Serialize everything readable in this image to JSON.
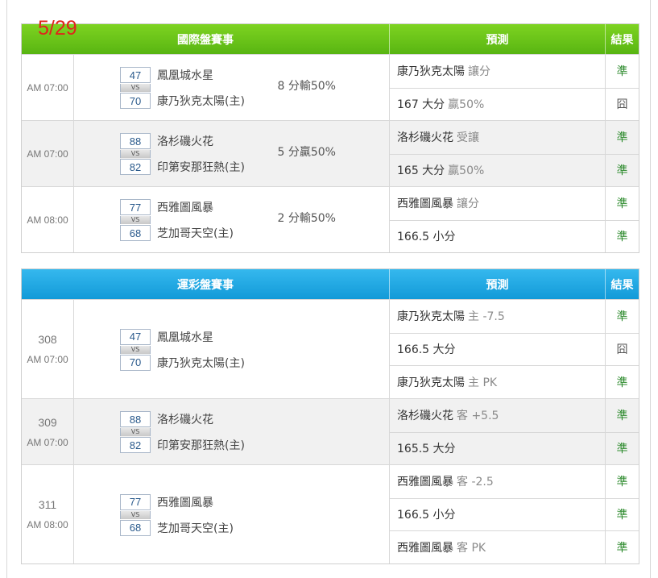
{
  "date": "5/29",
  "intl": {
    "header": {
      "event": "國際盤賽事",
      "prediction": "預測",
      "result": "結果"
    },
    "games": [
      {
        "time": "AM 07:00",
        "away_score": "47",
        "away": "鳳凰城水星",
        "home_score": "70",
        "home": "康乃狄克太陽(主)",
        "odds": "8 分輸50%",
        "preds": [
          {
            "main": "康乃狄克太陽",
            "sub": "讓分",
            "result": "準"
          },
          {
            "main": "167 大分",
            "sub": "贏50%",
            "result": "囧"
          }
        ]
      },
      {
        "time": "AM 07:00",
        "away_score": "88",
        "away": "洛杉磯火花",
        "home_score": "82",
        "home": "印第安那狂熱(主)",
        "odds": "5 分贏50%",
        "preds": [
          {
            "main": "洛杉磯火花",
            "sub": "受讓",
            "result": "準"
          },
          {
            "main": "165 大分",
            "sub": "贏50%",
            "result": "準"
          }
        ]
      },
      {
        "time": "AM 08:00",
        "away_score": "77",
        "away": "西雅圖風暴",
        "home_score": "68",
        "home": "芝加哥天空(主)",
        "odds": "2 分輸50%",
        "preds": [
          {
            "main": "西雅圖風暴",
            "sub": "讓分",
            "result": "準"
          },
          {
            "main": "166.5 小分",
            "sub": "",
            "result": "準"
          }
        ]
      }
    ]
  },
  "sport": {
    "header": {
      "event": "運彩盤賽事",
      "prediction": "預測",
      "result": "結果"
    },
    "games": [
      {
        "num": "308",
        "time": "AM 07:00",
        "away_score": "47",
        "away": "鳳凰城水星",
        "home_score": "70",
        "home": "康乃狄克太陽(主)",
        "preds": [
          {
            "main": "康乃狄克太陽",
            "sub": "主 -7.5",
            "result": "準"
          },
          {
            "main": "166.5 大分",
            "sub": "",
            "result": "囧"
          },
          {
            "main": "康乃狄克太陽",
            "sub": "主 PK",
            "result": "準"
          }
        ]
      },
      {
        "num": "309",
        "time": "AM 07:00",
        "away_score": "88",
        "away": "洛杉磯火花",
        "home_score": "82",
        "home": "印第安那狂熱(主)",
        "preds": [
          {
            "main": "洛杉磯火花",
            "sub": "客 +5.5",
            "result": "準"
          },
          {
            "main": "165.5 大分",
            "sub": "",
            "result": "準"
          }
        ]
      },
      {
        "num": "311",
        "time": "AM 08:00",
        "away_score": "77",
        "away": "西雅圖風暴",
        "home_score": "68",
        "home": "芝加哥天空(主)",
        "preds": [
          {
            "main": "西雅圖風暴",
            "sub": "客 -2.5",
            "result": "準"
          },
          {
            "main": "166.5 小分",
            "sub": "",
            "result": "準"
          },
          {
            "main": "西雅圖風暴",
            "sub": "客 PK",
            "result": "準"
          }
        ]
      }
    ]
  },
  "vs_label": "VS"
}
